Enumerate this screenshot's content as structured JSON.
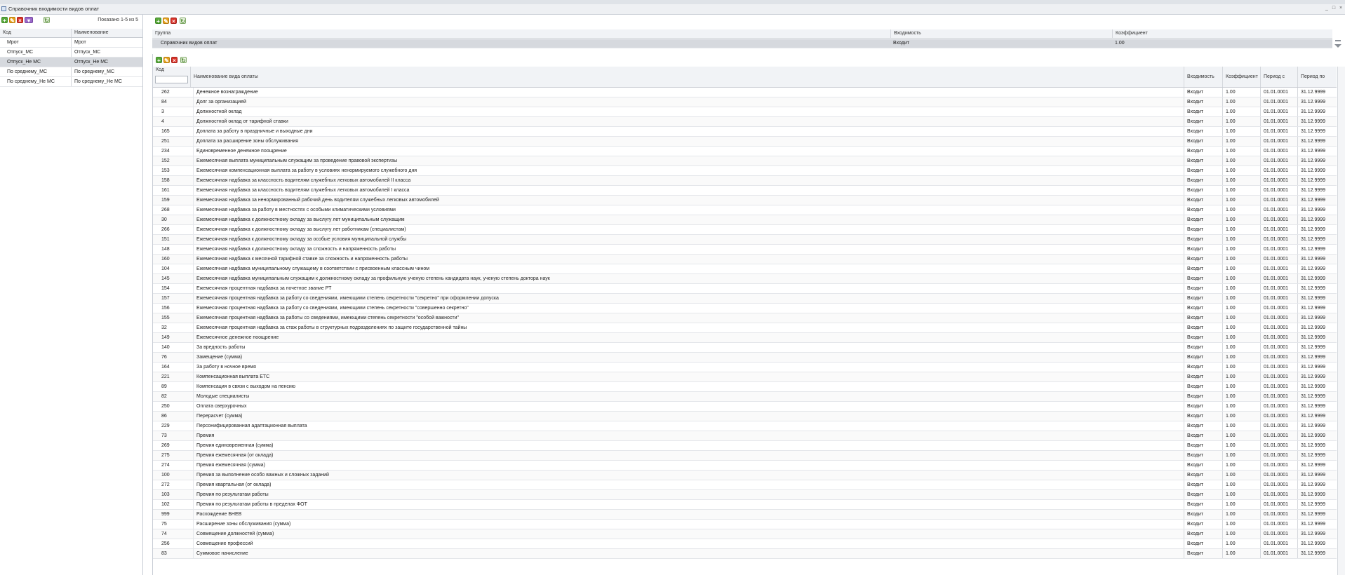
{
  "window": {
    "title": "Справочник входимости видов оплат",
    "controls": [
      "_",
      "□",
      "×"
    ]
  },
  "left": {
    "paging": "Показано 1-5 из 5",
    "columns": [
      "Код",
      "Наименование"
    ],
    "rows": [
      [
        "Мрот",
        "Мрот"
      ],
      [
        "Отпуск_МС",
        "Отпуск_МС"
      ],
      [
        "Отпуск_Не МС",
        "Отпуск_Не МС"
      ],
      [
        "По среднему_МС",
        "По среднему_МС"
      ],
      [
        "По среднему_Не МС",
        "По среднему_Не МС"
      ]
    ],
    "selected_index": 2
  },
  "groups": {
    "columns": [
      "Группа",
      "Входимость",
      "Коэффициент"
    ],
    "rows": [
      [
        "Справочник видов оплат",
        "Входит",
        "1.00"
      ]
    ]
  },
  "payments": {
    "columns": [
      "Код",
      "Наименование вида оплаты",
      "Входимость",
      "Коэффициент",
      "Период с",
      "Период по"
    ],
    "rows": [
      [
        "262",
        "Денежное вознаграждение",
        "Входит",
        "1.00",
        "01.01.0001",
        "31.12.9999"
      ],
      [
        "84",
        "Долг за организацией",
        "Входит",
        "1.00",
        "01.01.0001",
        "31.12.9999"
      ],
      [
        "3",
        "Должностной оклад",
        "Входит",
        "1.00",
        "01.01.0001",
        "31.12.9999"
      ],
      [
        "4",
        "Должностной оклад от тарифной ставки",
        "Входит",
        "1.00",
        "01.01.0001",
        "31.12.9999"
      ],
      [
        "165",
        "Доплата за работу в праздничные и выходные дни",
        "Входит",
        "1.00",
        "01.01.0001",
        "31.12.9999"
      ],
      [
        "251",
        "Доплата за расширение зоны обслуживания",
        "Входит",
        "1.00",
        "01.01.0001",
        "31.12.9999"
      ],
      [
        "234",
        "Единовременное денежное поощрение",
        "Входит",
        "1.00",
        "01.01.0001",
        "31.12.9999"
      ],
      [
        "152",
        "Ежемесячная выплата муниципальным служащим за проведение правовой экспертизы",
        "Входит",
        "1.00",
        "01.01.0001",
        "31.12.9999"
      ],
      [
        "153",
        "Ежемесячная компенсационная выплата за работу в условиях ненормируемого служебного дня",
        "Входит",
        "1.00",
        "01.01.0001",
        "31.12.9999"
      ],
      [
        "158",
        "Ежемесячная надбавка за классность водителям служебных легковых автомобилей II класса",
        "Входит",
        "1.00",
        "01.01.0001",
        "31.12.9999"
      ],
      [
        "161",
        "Ежемесячная надбавка за классность водителям служебных легковых автомобилей I класса",
        "Входит",
        "1.00",
        "01.01.0001",
        "31.12.9999"
      ],
      [
        "159",
        "Ежемесячная надбавка за ненормированный рабочий день водителям служебных легковых автомобилей",
        "Входит",
        "1.00",
        "01.01.0001",
        "31.12.9999"
      ],
      [
        "268",
        "Ежемесячная надбавка за работу в местностях с особыми климатическими условиями",
        "Входит",
        "1.00",
        "01.01.0001",
        "31.12.9999"
      ],
      [
        "30",
        "Ежемесячная надбавка к должностному окладу за выслугу лет муниципальным служащим",
        "Входит",
        "1.00",
        "01.01.0001",
        "31.12.9999"
      ],
      [
        "266",
        "Ежемесячная надбавка к должностному окладу за выслугу лет работникам (специалистам)",
        "Входит",
        "1.00",
        "01.01.0001",
        "31.12.9999"
      ],
      [
        "151",
        "Ежемесячная надбавка к должностному окладу за особые условия муниципальной службы",
        "Входит",
        "1.00",
        "01.01.0001",
        "31.12.9999"
      ],
      [
        "148",
        "Ежемесячная надбавка к должностному окладу за сложность и напряженность работы",
        "Входит",
        "1.00",
        "01.01.0001",
        "31.12.9999"
      ],
      [
        "160",
        "Ежемесячная надбавка к месячной тарифной ставке за сложность и напряженность работы",
        "Входит",
        "1.00",
        "01.01.0001",
        "31.12.9999"
      ],
      [
        "104",
        "Ежемесячная надбавка муниципальному служащему в соответствии с присвоенным классным чином",
        "Входит",
        "1.00",
        "01.01.0001",
        "31.12.9999"
      ],
      [
        "145",
        "Ежемесячная надбавка муниципальным служащим к должностному окладу за профильную ученую степень кандидата наук, ученую степень доктора наук",
        "Входит",
        "1.00",
        "01.01.0001",
        "31.12.9999"
      ],
      [
        "154",
        "Ежемесячная процентная надбавка за почетное звание РТ",
        "Входит",
        "1.00",
        "01.01.0001",
        "31.12.9999"
      ],
      [
        "157",
        "Ежемесячная процентная надбавка за работу со сведениями, имеющими степень секретности \"секретно\" при оформлении допуска",
        "Входит",
        "1.00",
        "01.01.0001",
        "31.12.9999"
      ],
      [
        "156",
        "Ежемесячная процентная надбавка за работу со сведениями, имеющими степень секретности \"совершенно секретно\"",
        "Входит",
        "1.00",
        "01.01.0001",
        "31.12.9999"
      ],
      [
        "155",
        "Ежемесячная процентная надбавка за работы со сведениями, имеющими степень секретности \"особой важности\"",
        "Входит",
        "1.00",
        "01.01.0001",
        "31.12.9999"
      ],
      [
        "32",
        "Ежемесячная процентная надбавка за стаж работы в структурных подразделениях по защите государственной тайны",
        "Входит",
        "1.00",
        "01.01.0001",
        "31.12.9999"
      ],
      [
        "149",
        "Ежемесячное денежное поощрение",
        "Входит",
        "1.00",
        "01.01.0001",
        "31.12.9999"
      ],
      [
        "140",
        "За вредность работы",
        "Входит",
        "1.00",
        "01.01.0001",
        "31.12.9999"
      ],
      [
        "76",
        "Замещение (сумма)",
        "Входит",
        "1.00",
        "01.01.0001",
        "31.12.9999"
      ],
      [
        "164",
        "За работу в ночное время",
        "Входит",
        "1.00",
        "01.01.0001",
        "31.12.9999"
      ],
      [
        "221",
        "Компенсационная выплата ЕТС",
        "Входит",
        "1.00",
        "01.01.0001",
        "31.12.9999"
      ],
      [
        "89",
        "Компенсация в связи с выходом на пенсию",
        "Входит",
        "1.00",
        "01.01.0001",
        "31.12.9999"
      ],
      [
        "82",
        "Молодые специалисты",
        "Входит",
        "1.00",
        "01.01.0001",
        "31.12.9999"
      ],
      [
        "250",
        "Оплата сверхурочных",
        "Входит",
        "1.00",
        "01.01.0001",
        "31.12.9999"
      ],
      [
        "86",
        "Перерасчет (сумма)",
        "Входит",
        "1.00",
        "01.01.0001",
        "31.12.9999"
      ],
      [
        "229",
        "Персонифицированная адаптационная выплата",
        "Входит",
        "1.00",
        "01.01.0001",
        "31.12.9999"
      ],
      [
        "73",
        "Премия",
        "Входит",
        "1.00",
        "01.01.0001",
        "31.12.9999"
      ],
      [
        "269",
        "Премия единовременная (сумма)",
        "Входит",
        "1.00",
        "01.01.0001",
        "31.12.9999"
      ],
      [
        "275",
        "Премия ежемесячная (от оклада)",
        "Входит",
        "1.00",
        "01.01.0001",
        "31.12.9999"
      ],
      [
        "274",
        "Премия ежемесячная (сумма)",
        "Входит",
        "1.00",
        "01.01.0001",
        "31.12.9999"
      ],
      [
        "100",
        "Премия за выполнение особо важных и сложных заданий",
        "Входит",
        "1.00",
        "01.01.0001",
        "31.12.9999"
      ],
      [
        "272",
        "Премия квартальная (от оклада)",
        "Входит",
        "1.00",
        "01.01.0001",
        "31.12.9999"
      ],
      [
        "103",
        "Премия по результатам работы",
        "Входит",
        "1.00",
        "01.01.0001",
        "31.12.9999"
      ],
      [
        "102",
        "Премия по результатам работы в пределах ФОТ",
        "Входит",
        "1.00",
        "01.01.0001",
        "31.12.9999"
      ],
      [
        "999",
        "Расхождение БНЕВ",
        "Входит",
        "1.00",
        "01.01.0001",
        "31.12.9999"
      ],
      [
        "75",
        "Расширение зоны обслуживания (сумма)",
        "Входит",
        "1.00",
        "01.01.0001",
        "31.12.9999"
      ],
      [
        "74",
        "Совмещение должностей (сумма)",
        "Входит",
        "1.00",
        "01.01.0001",
        "31.12.9999"
      ],
      [
        "256",
        "Совмещение профессий",
        "Входит",
        "1.00",
        "01.01.0001",
        "31.12.9999"
      ],
      [
        "83",
        "Суммовое начисление",
        "Входит",
        "1.00",
        "01.01.0001",
        "31.12.9999"
      ]
    ]
  },
  "toolbar_icons": [
    "add-icon",
    "edit-icon",
    "delete-icon",
    "options-icon",
    "refresh-icon"
  ]
}
